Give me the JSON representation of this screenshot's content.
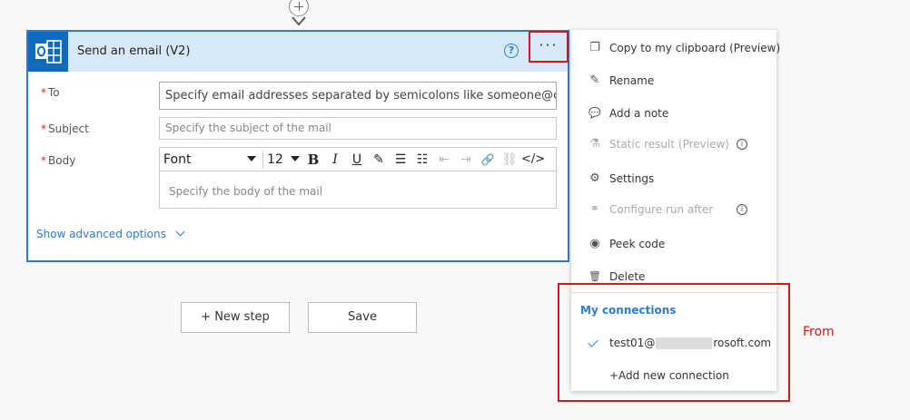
{
  "card": {
    "title": "Send an email (V2)",
    "help_symbol": "?",
    "more_symbol": "···",
    "fields": {
      "to": {
        "label": "To",
        "value": "Specify email addresses separated by semicolons like someone@c..."
      },
      "subject": {
        "label": "Subject",
        "placeholder": "Specify the subject of the mail"
      },
      "body": {
        "label": "Body",
        "placeholder": "Specify the body of the mail"
      }
    },
    "required_mark": "*",
    "toolbar": {
      "font": "Font",
      "size": "12",
      "bold": "B",
      "italic": "I",
      "underline": "U",
      "highlight": "✎",
      "bullets": "☰",
      "numbered": "☷",
      "outdent": "⇤",
      "indent": "⇥",
      "link": "🔗",
      "unlink": "⛓",
      "code": "</>"
    },
    "advanced_options": "Show advanced options"
  },
  "buttons": {
    "new_step": "+ New step",
    "save": "Save"
  },
  "menu": {
    "items": [
      {
        "label": "Copy to my clipboard (Preview)",
        "icon": "copy-icon",
        "glyph": "❐"
      },
      {
        "label": "Rename",
        "icon": "pencil-icon",
        "glyph": "✎"
      },
      {
        "label": "Add a note",
        "icon": "comment-icon",
        "glyph": "💬"
      },
      {
        "label": "Static result (Preview)",
        "icon": "flask-icon",
        "glyph": "⚗"
      },
      {
        "label": "Settings",
        "icon": "gear-icon",
        "glyph": "⚙"
      },
      {
        "label": "Configure run after",
        "icon": "flow-icon",
        "glyph": "⚭"
      },
      {
        "label": "Peek code",
        "icon": "eye-icon",
        "glyph": "◉"
      },
      {
        "label": "Delete",
        "icon": "trash-icon",
        "glyph": "🗑"
      }
    ],
    "info_symbol": "i",
    "connections": {
      "header": "My connections",
      "email_prefix": "test01@",
      "email_suffix": "rosoft.com",
      "add": "+Add new connection"
    }
  },
  "annotation": {
    "label": "From"
  },
  "colors": {
    "accent": "#2e7bcf",
    "annotation": "#d01a1a",
    "header_bg": "#d7e9f8"
  }
}
